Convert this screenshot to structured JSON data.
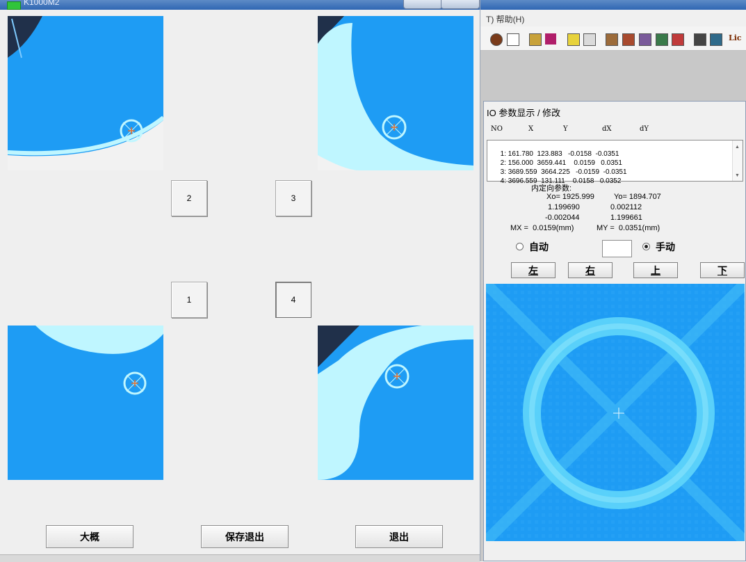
{
  "left_window": {
    "title": "K1000M2",
    "corner_buttons": [
      {
        "label": "2",
        "pressed": false
      },
      {
        "label": "3",
        "pressed": false
      },
      {
        "label": "1",
        "pressed": false
      },
      {
        "label": "4",
        "pressed": true
      }
    ],
    "bottom_buttons": [
      "大概",
      "保存退出",
      "退出"
    ]
  },
  "background_app": {
    "menu_item": "T)  帮助(H)",
    "toolbar_text": "Lic"
  },
  "dialog": {
    "title": "IO 参数显示 / 修改",
    "columns": [
      "NO",
      "X",
      "Y",
      "dX",
      "dY"
    ],
    "rows": [
      {
        "no": "1:",
        "x": "161.780",
        "y": "123.883",
        "dx": "-0.0158",
        "dy": "-0.0351"
      },
      {
        "no": "2:",
        "x": "156.000",
        "y": "3659.441",
        "dx": "0.0159",
        "dy": "0.0351"
      },
      {
        "no": "3:",
        "x": "3689.559",
        "y": "3664.225",
        "dx": "-0.0159",
        "dy": "-0.0351"
      },
      {
        "no": "4:",
        "x": "3696.559",
        "y": "131.111",
        "dx": "0.0158",
        "dy": "0.0352"
      }
    ],
    "io_label": "内定向参数:",
    "xo": "Xo= 1925.999",
    "yo": "Yo= 1894.707",
    "m11": "1.199690",
    "m12": "0.002112",
    "m21": "-0.002044",
    "m22": "1.199661",
    "mx": "MX =  0.0159(mm)",
    "my": "MY =  0.0351(mm)",
    "auto_label": "自动",
    "manual_label": "手动",
    "mode": "manual",
    "input_value": "",
    "direction_buttons": [
      "左",
      "右",
      "上",
      "下"
    ]
  },
  "colors": {
    "fiducial_blue": "#1e9cf4",
    "highlight_cyan": "#bff6ff",
    "dark": "#20304a"
  }
}
